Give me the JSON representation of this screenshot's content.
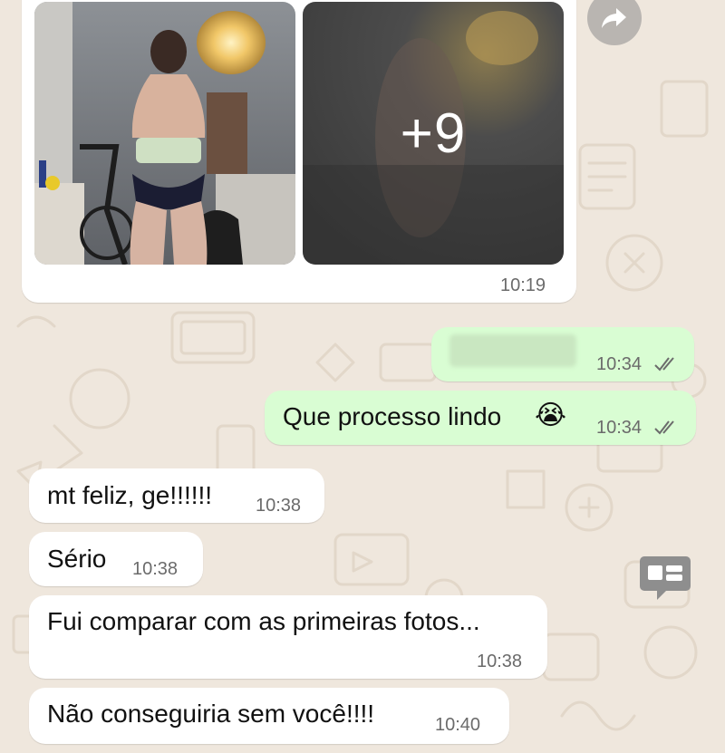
{
  "media_message": {
    "more_photos_label": "+9",
    "time": "10:19"
  },
  "messages": [
    {
      "text": "",
      "time": "10:34",
      "direction": "outgoing",
      "status": "read",
      "blurred": true
    },
    {
      "text": "Que processo lindo",
      "emoji": "😭",
      "time": "10:34",
      "direction": "outgoing",
      "status": "read"
    },
    {
      "text": "mt feliz, ge!!!!!!",
      "time": "10:38",
      "direction": "incoming"
    },
    {
      "text": "Sério",
      "time": "10:38",
      "direction": "incoming"
    },
    {
      "text": "Fui comparar com as primeiras fotos...",
      "time": "10:38",
      "direction": "incoming"
    },
    {
      "text": "Não conseguiria sem você!!!!",
      "time": "10:40",
      "direction": "incoming"
    }
  ],
  "icons": {
    "forward": "forward-icon",
    "read_receipt": "double-check-icon",
    "floating": "chat-summary-icon",
    "emoji": "crying-face-emoji"
  },
  "colors": {
    "chat_background": "#efe7dd",
    "incoming_bubble": "#ffffff",
    "outgoing_bubble": "#d9fdd3",
    "timestamp": "#6b6b6b"
  }
}
